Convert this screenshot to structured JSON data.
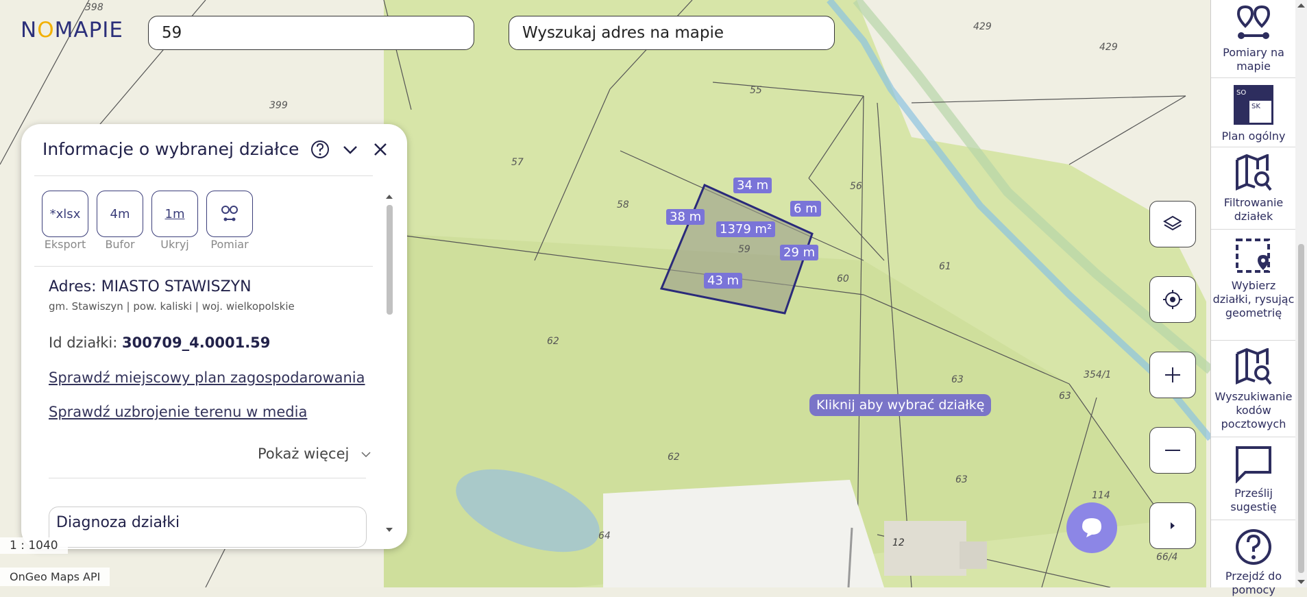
{
  "search": {
    "plot_value": "59",
    "address_placeholder": "Wyszukaj adres na mapie"
  },
  "logo": {
    "text_a": "N",
    "text_o": "O",
    "text_b": "MAPIE"
  },
  "panel": {
    "title": "Informacje o wybranej działce",
    "tools": [
      {
        "label": "Eksport",
        "content": "*xlsx"
      },
      {
        "label": "Bufor",
        "content": "4m"
      },
      {
        "label": "Ukryj",
        "content": "1m"
      },
      {
        "label": "Pomiar",
        "content": ""
      }
    ],
    "address_label": "Adres: MIASTO STAWISZYN",
    "address_sub": "gm. Stawiszyn | pow. kaliski | woj. wielkopolskie",
    "id_label": "Id działki:",
    "id_value": "300709_4.0001.59",
    "link_plan": "Sprawdź miejscowy plan zagospodarowania",
    "link_media": "Sprawdź uzbrojenie terenu w media",
    "show_more": "Pokaż więcej",
    "diagnosis": "Diagnoza działki"
  },
  "map": {
    "parcel_numbers": [
      "398",
      "399",
      "57",
      "58",
      "55",
      "56",
      "59",
      "60",
      "61",
      "62",
      "62",
      "63",
      "63",
      "63",
      "64",
      "12",
      "114",
      "354/1",
      "66/4",
      "429",
      "429"
    ],
    "measurements": {
      "top": "34 m",
      "left": "38 m",
      "right_top": "6 m",
      "right": "29 m",
      "bottom": "43 m",
      "area": "1379 m²"
    },
    "tooltip": "Kliknij aby wybrać działkę",
    "scale": "1 : 1040",
    "credit": "OnGeo Maps API"
  },
  "sidebar": {
    "items": [
      {
        "label": "Pomiary na mapie",
        "icon": "pins-measure-icon"
      },
      {
        "label": "Plan ogólny",
        "icon": "plan-icon"
      },
      {
        "label": "Filtrowanie działek",
        "icon": "map-search-icon"
      },
      {
        "label": "Wybierz działki, rysując geometrię",
        "icon": "select-draw-icon"
      },
      {
        "label": "Wyszukiwanie kodów pocztowych",
        "icon": "map-search-icon"
      },
      {
        "label": "Prześlij sugestię",
        "icon": "chat-icon"
      },
      {
        "label": "Przejdź do pomocy",
        "icon": "help-icon"
      }
    ],
    "plan_badge_a": "SO",
    "plan_badge_b": "SK"
  },
  "colors": {
    "field_green": "#cfe0a0",
    "parcel_outline": "#2a2a7a",
    "label_purple": "#7a74d8",
    "brand": "#2b2f7a"
  }
}
